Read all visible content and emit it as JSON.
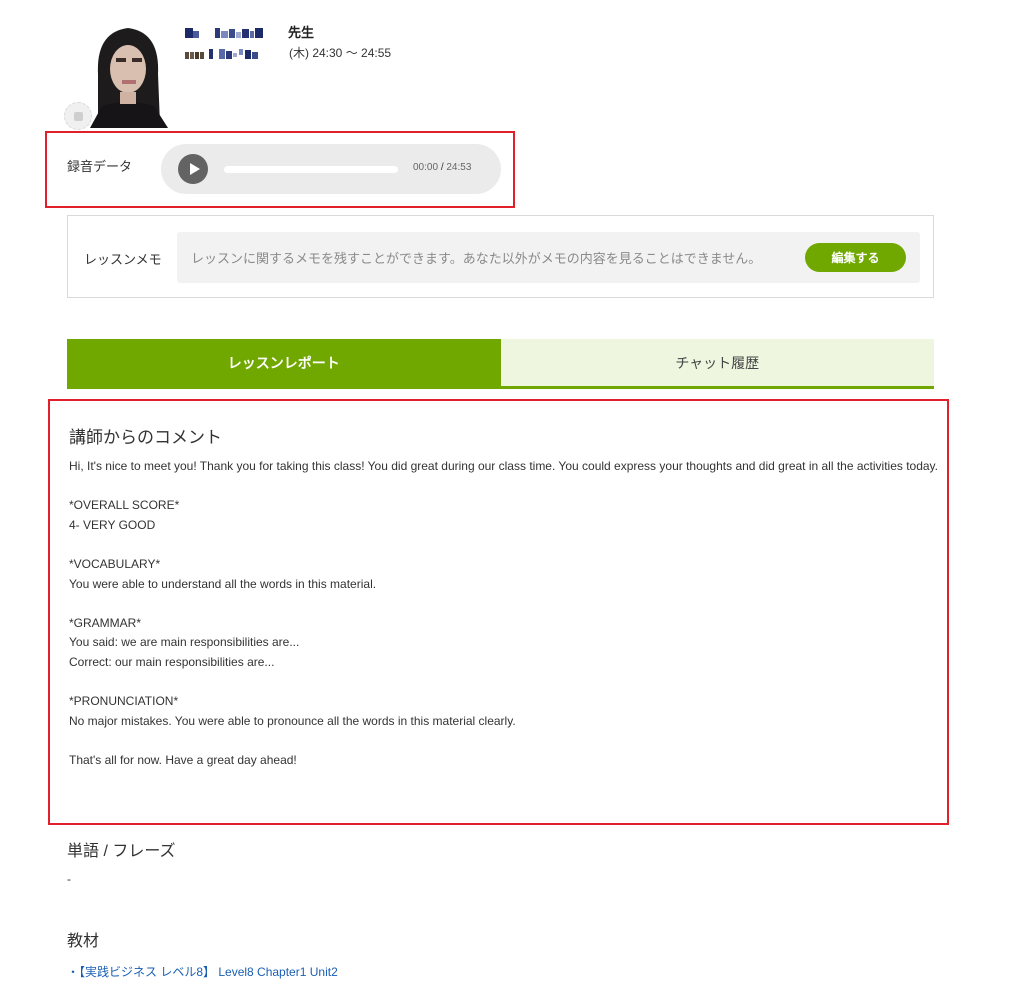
{
  "teacher": {
    "name_suffix": "先生",
    "time_suffix": "(木) 24:30 ～ 24:55"
  },
  "recording": {
    "label": "録音データ",
    "current_time": "00:00",
    "separator": "/",
    "total_time": "24:53",
    "progress": 0
  },
  "memo": {
    "label": "レッスンメモ",
    "placeholder": "レッスンに関するメモを残すことができます。あなた以外がメモの内容を見ることはできません。",
    "edit_button": "編集する"
  },
  "tabs": [
    {
      "label": "レッスンレポート",
      "active": true
    },
    {
      "label": "チャット履歴",
      "active": false
    }
  ],
  "comment": {
    "title": "講師からのコメント",
    "body": "Hi, It's nice to meet you! Thank you for taking this class! You did great during our class time. You could express your thoughts and did great in all the activities today.\n\n*OVERALL SCORE*\n4- VERY GOOD\n\n*VOCABULARY*\nYou were able to understand all the words in this material.\n\n*GRAMMAR*\nYou said: we are main responsibilities are...\nCorrect: our main responsibilities are...\n\n*PRONUNCIATION*\nNo major mistakes. You were able to pronounce all the words in this material clearly.\n\nThat's all for now. Have a great day ahead!"
  },
  "words": {
    "title": "単語 / フレーズ",
    "value": "-"
  },
  "materials": {
    "title": "教材",
    "items": [
      {
        "label": "・【実践ビジネス レベル8】 Level8 Chapter1 Unit2"
      }
    ]
  },
  "colors": {
    "accent_green": "#70a800",
    "tab_inactive_bg": "#eef6e0",
    "highlight_red": "#e0202a",
    "link_blue": "#1a5fb4"
  }
}
